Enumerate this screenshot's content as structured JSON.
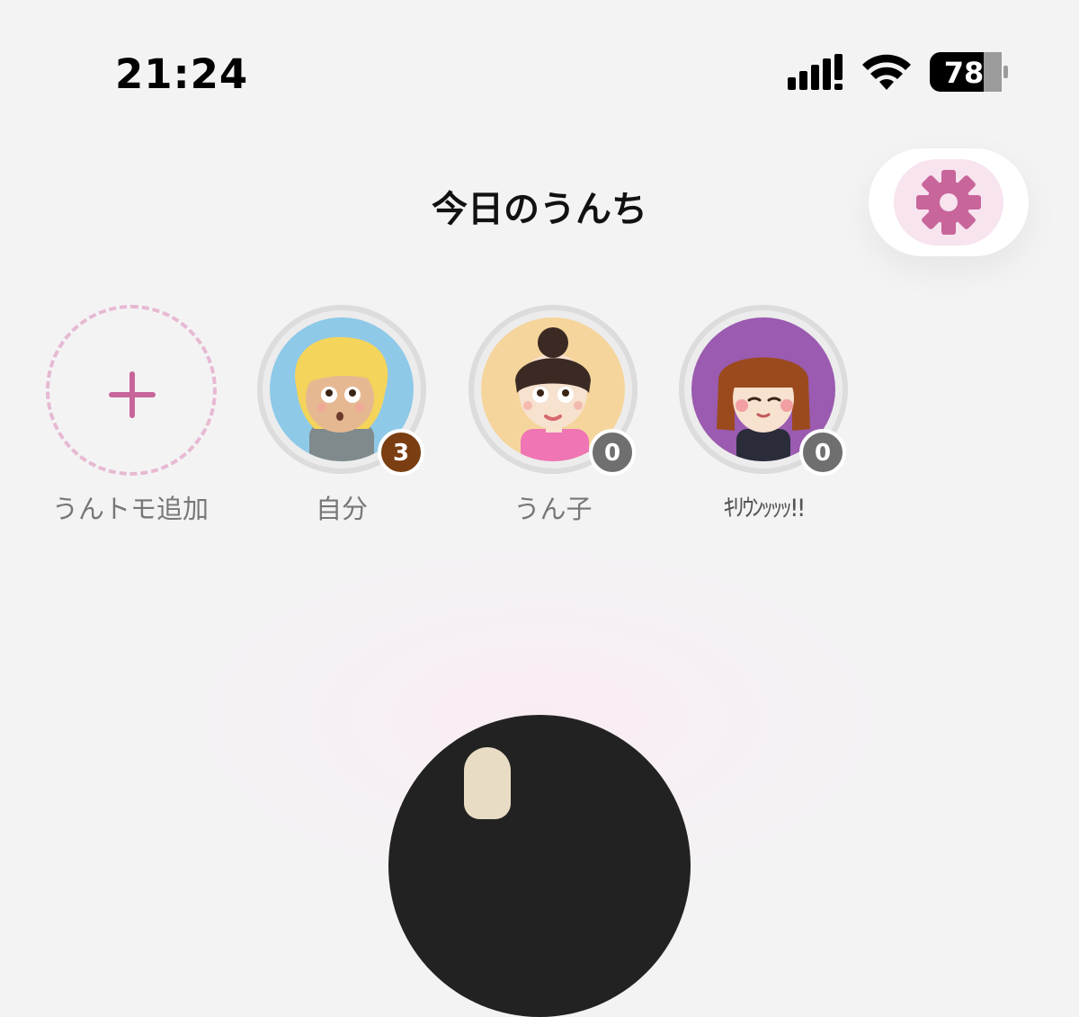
{
  "status_bar": {
    "time": "21:24",
    "battery_level": "78",
    "icons": [
      "cellular-signal-icon",
      "wifi-icon",
      "battery-icon"
    ]
  },
  "header": {
    "title": "今日のうんち",
    "settings_icon": "gear-icon"
  },
  "friends": {
    "add": {
      "label": "うんトモ追加",
      "icon": "plus-icon"
    },
    "items": [
      {
        "name": "自分",
        "count": "3",
        "badge_color": "#7a3e12",
        "avatar_bg": "#8ec9e8"
      },
      {
        "name": "うん子",
        "count": "0",
        "badge_color": "#6f6f6f",
        "avatar_bg": "#f5d59c"
      },
      {
        "name": "ｷﾘｳﾝｯｯｯ!!",
        "count": "0",
        "badge_color": "#6f6f6f",
        "avatar_bg": "#9a5bb0"
      }
    ]
  },
  "colors": {
    "accent": "#c8659a",
    "background": "#f4f3f4",
    "settings_bg": "#f7e4ef"
  }
}
